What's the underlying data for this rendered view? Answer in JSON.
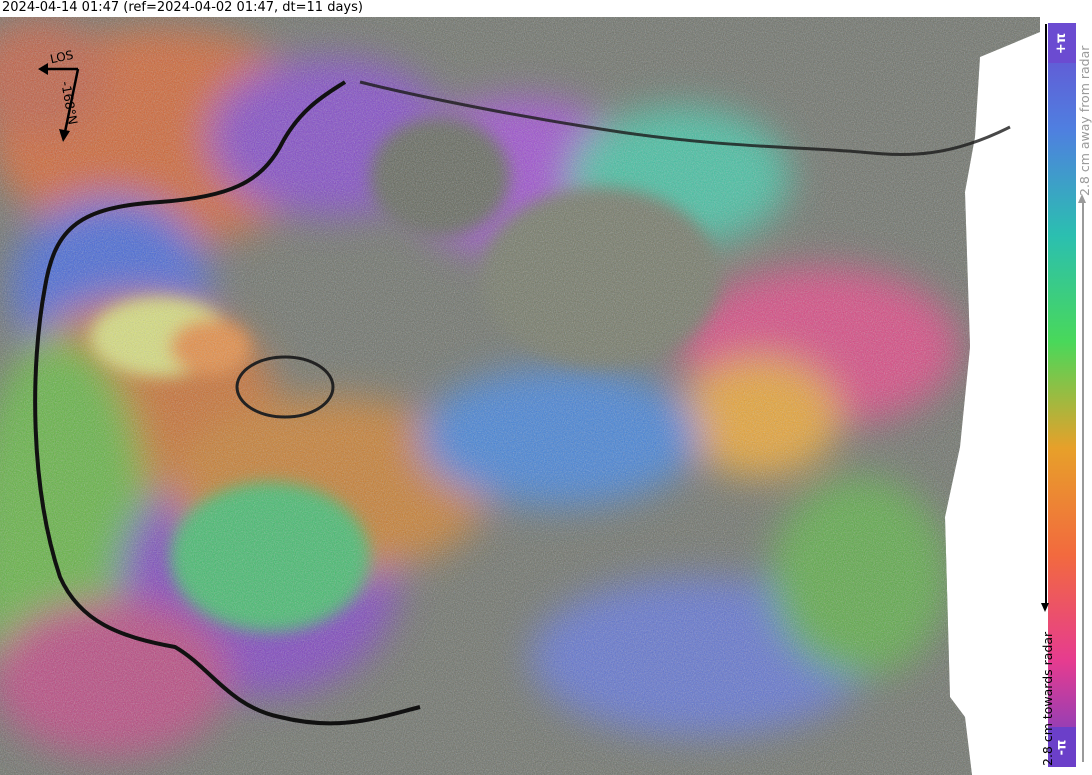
{
  "title": "2024-04-14 01:47 (ref=2024-04-02 01:47, dt=11 days)",
  "map": {
    "los_label": "LOS",
    "heading_label": "-168°N"
  },
  "colorbar": {
    "top_label": "+π",
    "bottom_label": "-π",
    "away_label": "2.8 cm away from radar",
    "towards_label": "2.8 cm towards radar",
    "colors": {
      "top": "#6b4bd1",
      "upper": "#4f7fe0",
      "mid_upper": "#2bbfb0",
      "mid": "#49d85a",
      "mid_lower": "#e7a02a",
      "lower": "#f26a3e",
      "low": "#e63c8f",
      "bottom": "#6b3fc9"
    }
  }
}
